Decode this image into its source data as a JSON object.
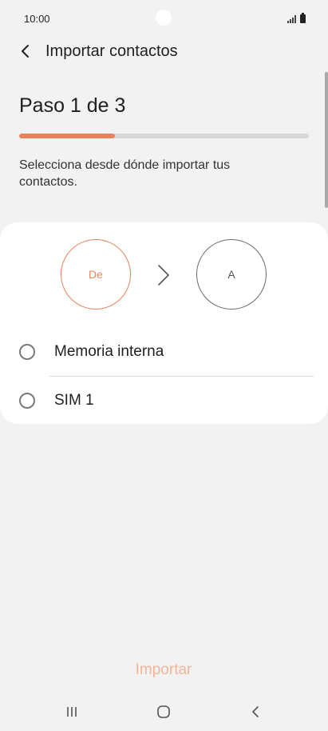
{
  "status_bar": {
    "time": "10:00"
  },
  "header": {
    "title": "Importar contactos",
    "back_icon": "chevron-left-icon"
  },
  "wizard": {
    "step_label": "Paso 1 de 3",
    "current_step": 1,
    "total_steps": 3,
    "progress_fraction": 0.33,
    "description": "Selecciona desde dónde importar tus contactos."
  },
  "transfer": {
    "from_label": "De",
    "to_label": "A",
    "arrow_icon": "chevron-right-icon"
  },
  "sources": [
    {
      "label": "Memoria interna",
      "selected": false
    },
    {
      "label": "SIM 1",
      "selected": false
    }
  ],
  "actions": {
    "import_label": "Importar",
    "import_enabled": false
  },
  "colors": {
    "accent": "#e8835c",
    "accent_disabled": "#f0b59a",
    "background": "#f2f2f2",
    "card": "#ffffff"
  },
  "nav_bar": {
    "recents_icon": "recents-icon",
    "home_icon": "home-icon",
    "back_icon": "back-icon"
  }
}
